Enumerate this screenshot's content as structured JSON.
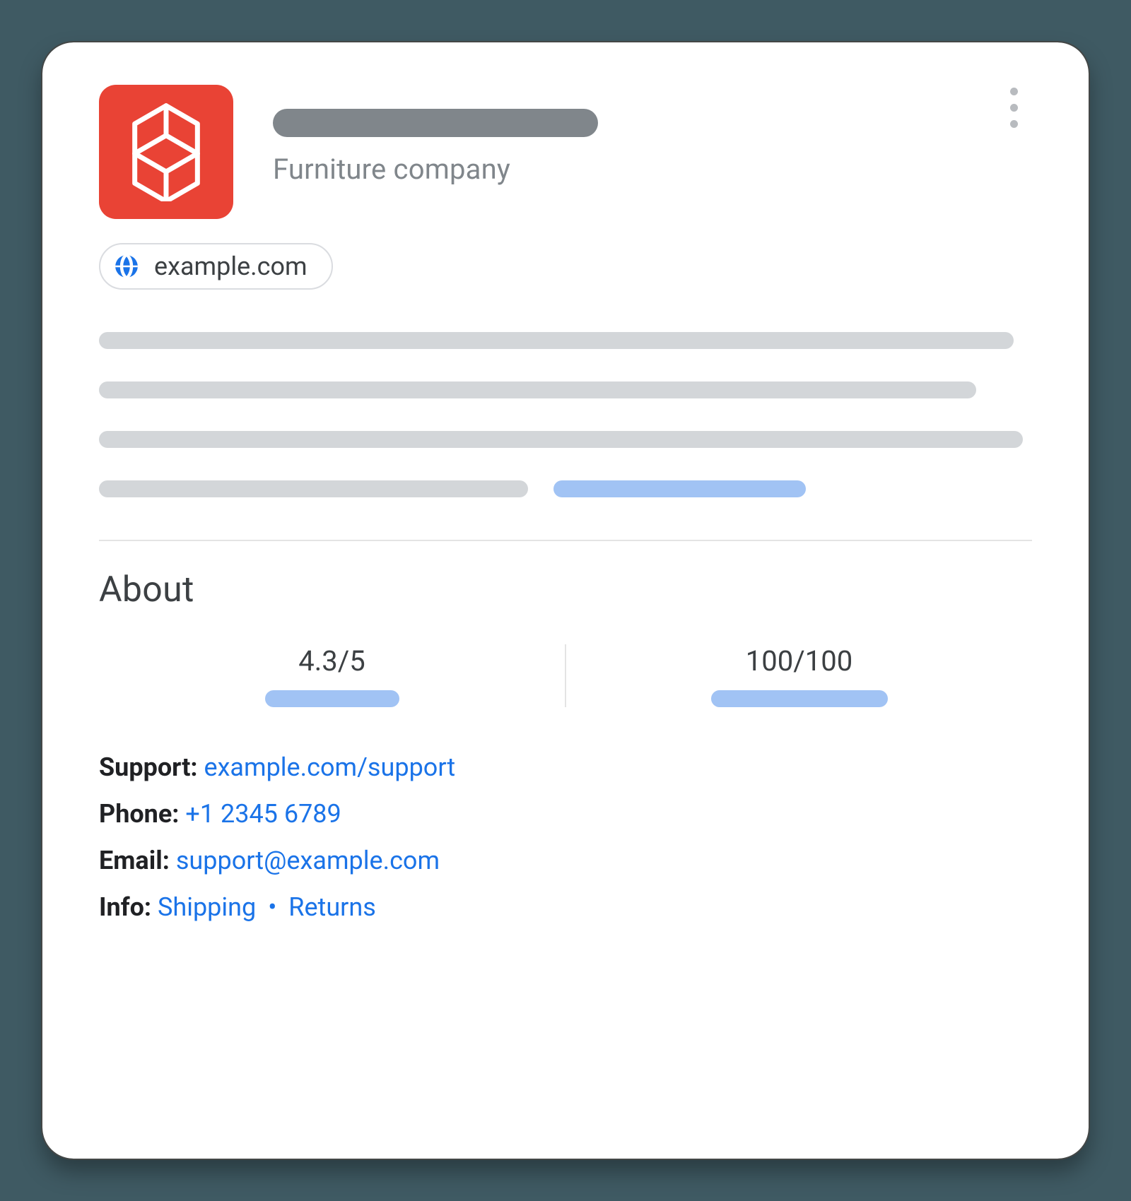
{
  "header": {
    "subtitle": "Furniture company",
    "url": "example.com",
    "logo_color": "#e94335"
  },
  "about": {
    "title": "About",
    "stats": [
      {
        "value": "4.3/5"
      },
      {
        "value": "100/100"
      }
    ]
  },
  "contact": {
    "support": {
      "label": "Support:",
      "link_text": "example.com/support"
    },
    "phone": {
      "label": "Phone:",
      "link_text": "+1 2345 6789"
    },
    "email": {
      "label": "Email:",
      "link_text": "support@example.com"
    },
    "info": {
      "label": "Info:",
      "links": [
        "Shipping",
        "Returns"
      ],
      "separator": "•"
    }
  },
  "colors": {
    "link": "#1a73e8",
    "skeleton_grey": "#d3d6d9",
    "skeleton_blue": "#a1c3f4"
  }
}
